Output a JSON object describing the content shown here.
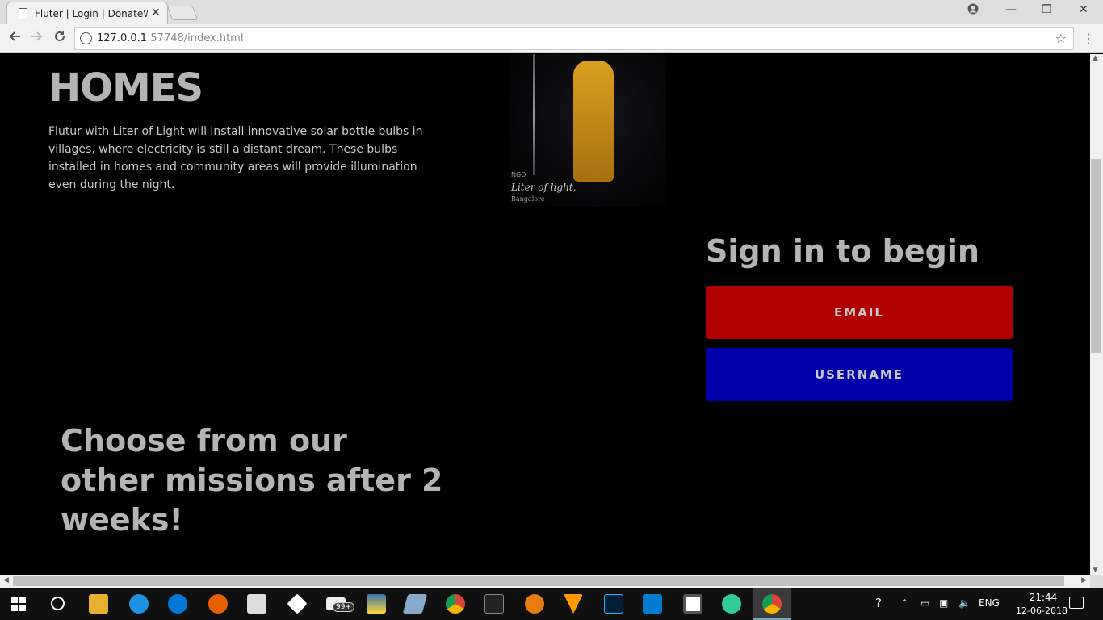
{
  "browser": {
    "tab_title": "Fluter | Login | DonateWi",
    "tab_close": "✕",
    "url_host": "127.0.0.1",
    "url_rest": ":57748/index.html",
    "win_minimize": "—",
    "win_restore": "❐",
    "win_close": "✕"
  },
  "main": {
    "homes_title": "HOMES",
    "homes_text": "Flutur with Liter of Light will install innovative solar bottle bulbs in villages, where electricity is still a distant dream. These bulbs installed in homes and community areas will provide illumination even during the night.",
    "image": {
      "ngo_label": "NGO",
      "brand": "Liter of light,",
      "city": "Bangalore"
    },
    "signin_title": "Sign in to begin",
    "email_button": "EMAIL",
    "username_button": "USERNAME",
    "missions_title": "Choose from our other missions after 2 weeks!"
  },
  "colors": {
    "email_button": "#b10000",
    "username_button": "#0000aa",
    "heading_text": "#b4b4b4",
    "page_bg": "#000000"
  },
  "taskbar": {
    "mail_badge": "99+",
    "language": "ENG",
    "time": "21:44",
    "date": "12-06-2018",
    "icons": [
      "start-icon",
      "cortana-icon",
      "file-explorer-icon",
      "ie-icon",
      "edge-icon",
      "firefox-icon",
      "store-icon",
      "dropbox-icon",
      "mail-icon",
      "python-icon",
      "notepad-icon",
      "chrome-icon",
      "terminal-icon",
      "blender-icon",
      "vlc-icon",
      "photoshop-icon",
      "vscode-icon",
      "app-icon",
      "atom-icon",
      "chrome-active-icon"
    ]
  }
}
